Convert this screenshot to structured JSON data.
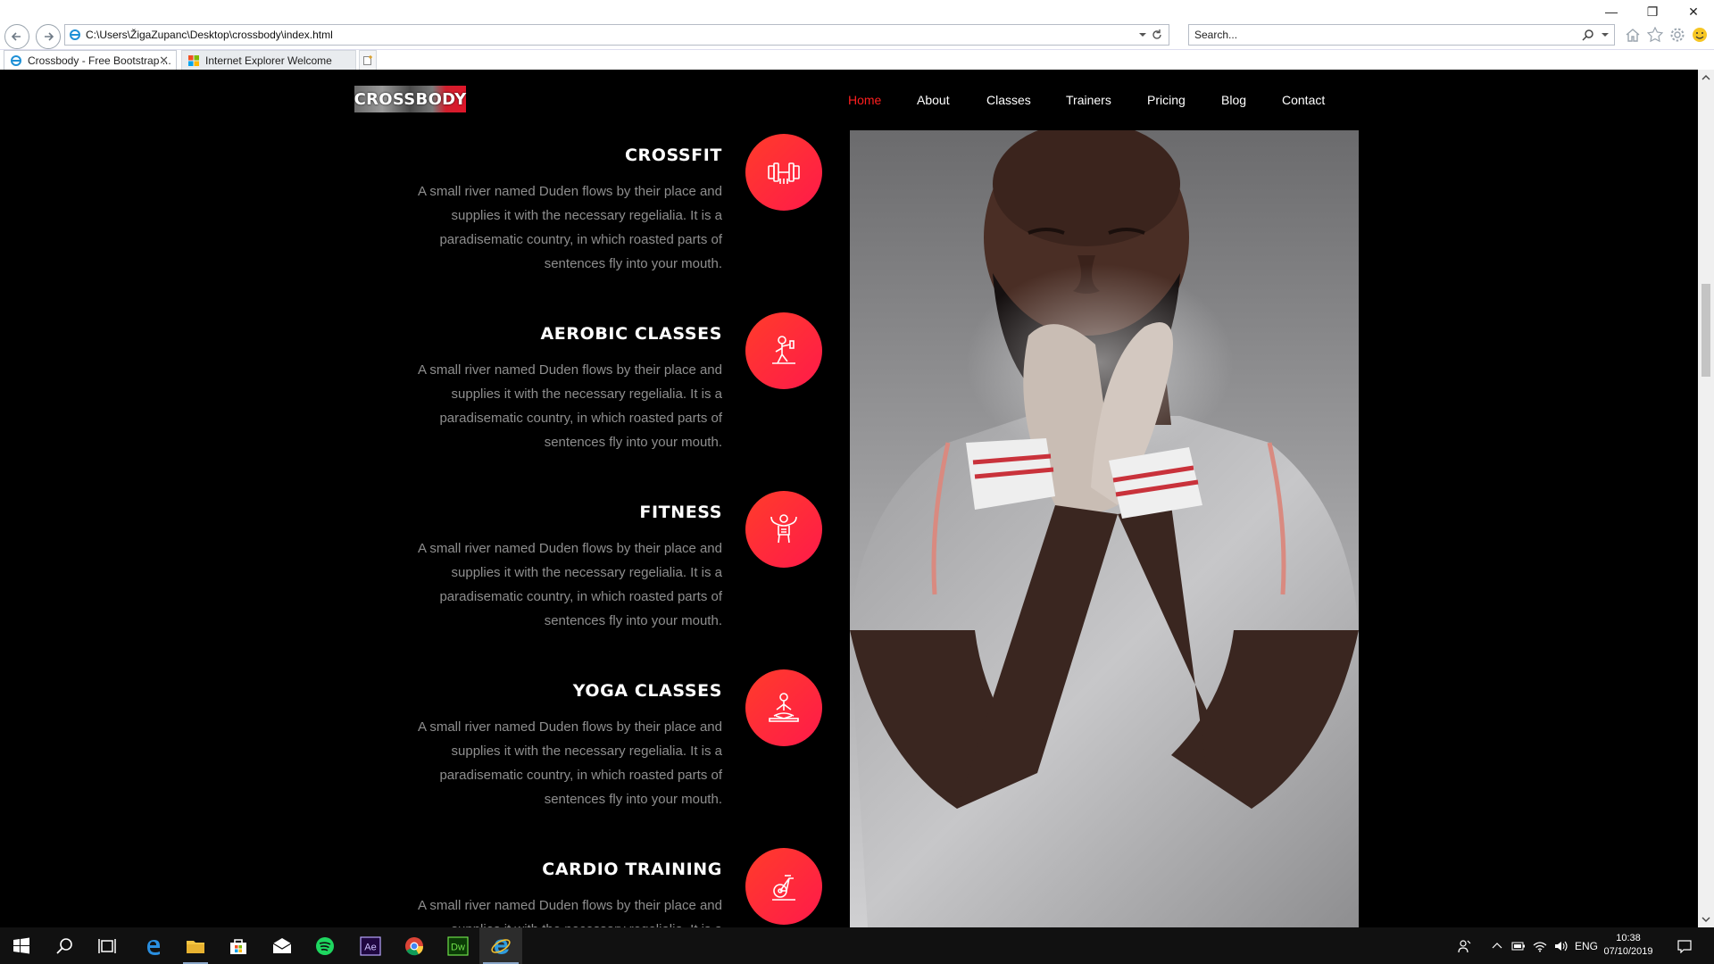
{
  "browser": {
    "address": "C:\\Users\\ŽigaZupanc\\Desktop\\crossbody\\index.html",
    "search_placeholder": "Search...",
    "tabs": [
      {
        "label": "Crossbody - Free Bootstrap ..."
      },
      {
        "label": "Internet Explorer Welcome"
      }
    ],
    "close_glyph": "✕",
    "window_controls": [
      "—",
      "❐",
      "✕"
    ]
  },
  "site": {
    "logo": "CROSSBODY",
    "nav": [
      {
        "label": "Home",
        "active": true
      },
      {
        "label": "About"
      },
      {
        "label": "Classes"
      },
      {
        "label": "Trainers"
      },
      {
        "label": "Pricing"
      },
      {
        "label": "Blog"
      },
      {
        "label": "Contact"
      }
    ],
    "services": [
      {
        "title": "CROSSFIT",
        "icon": "dumbbell-icon",
        "text": "A small river named Duden flows by their place and supplies it with the necessary regelialia. It is a paradisematic country, in which roasted parts of sentences fly into your mouth."
      },
      {
        "title": "AEROBIC CLASSES",
        "icon": "aerobic-person-icon",
        "text": "A small river named Duden flows by their place and supplies it with the necessary regelialia. It is a paradisematic country, in which roasted parts of sentences fly into your mouth."
      },
      {
        "title": "FITNESS",
        "icon": "bodybuilder-icon",
        "text": "A small river named Duden flows by their place and supplies it with the necessary regelialia. It is a paradisematic country, in which roasted parts of sentences fly into your mouth."
      },
      {
        "title": "YOGA CLASSES",
        "icon": "yoga-icon",
        "text": "A small river named Duden flows by their place and supplies it with the necessary regelialia. It is a paradisematic country, in which roasted parts of sentences fly into your mouth."
      },
      {
        "title": "CARDIO TRAINING",
        "icon": "exercise-bike-icon",
        "text": "A small river named Duden flows by their place and supplies it with the necessary regelialia. It is a paradisematic country, in which roasted parts of sentences fly into your mouth."
      }
    ],
    "accent_color": "#ff1f1f",
    "badge_colors": [
      "#ff3c2a",
      "#ff1a4a"
    ]
  },
  "taskbar": {
    "language": "ENG",
    "time": "10:38",
    "date": "07/10/2019",
    "apps": [
      "start-icon",
      "search-icon",
      "task-view-icon",
      "edge-icon",
      "file-explorer-icon",
      "store-icon",
      "mail-icon",
      "spotify-icon",
      "after-effects-icon",
      "chrome-icon",
      "dreamweaver-icon",
      "internet-explorer-icon"
    ],
    "ae_label": "Ae",
    "dw_label": "Dw"
  }
}
